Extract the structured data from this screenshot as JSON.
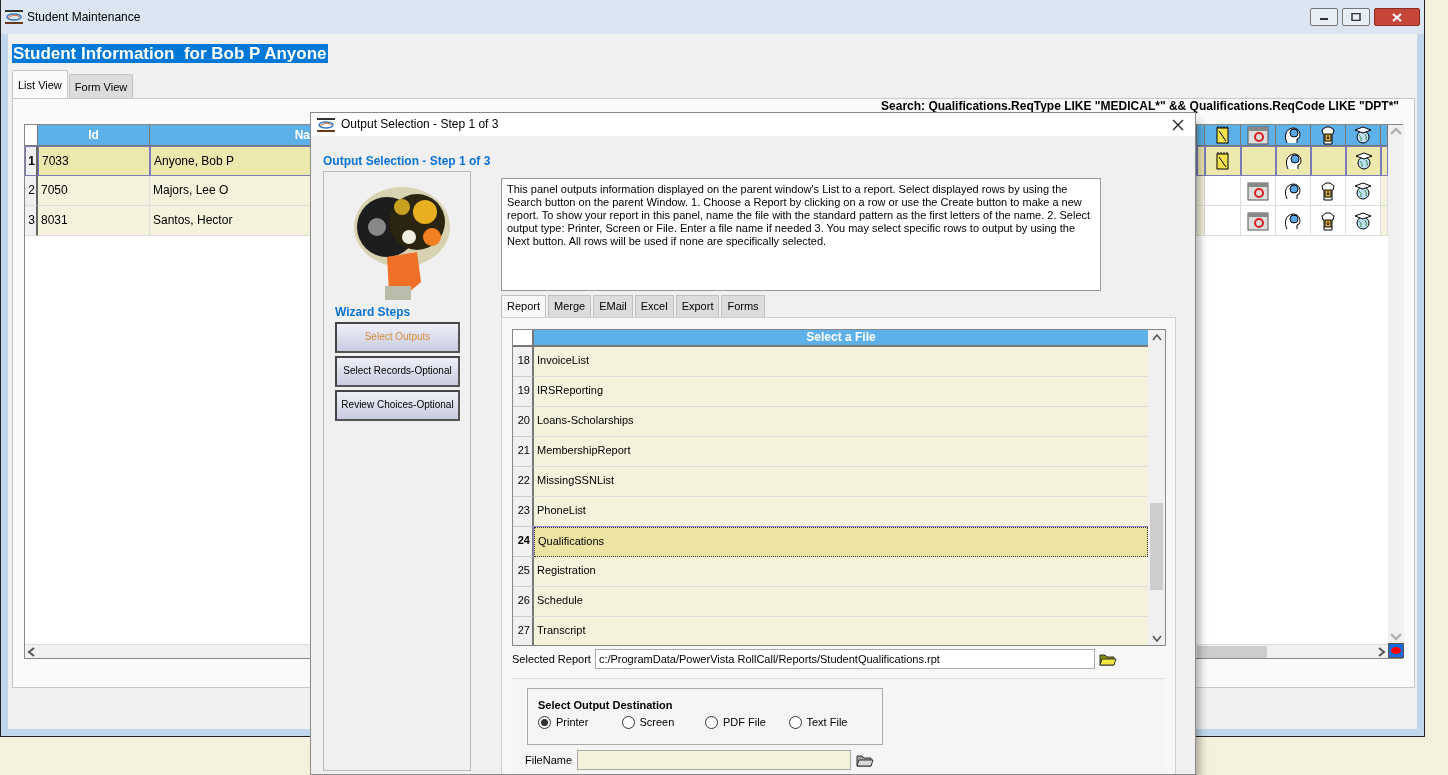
{
  "window": {
    "title": "Student Maintenance"
  },
  "heading": "Student Information  for Bob P Anyone",
  "tabs": [
    {
      "label": "List View",
      "selected": true
    },
    {
      "label": "Form View",
      "selected": false
    }
  ],
  "search_text": "Search: Qualifications.ReqType  LIKE \"MEDICAL*\" && Qualifications.ReqCode  LIKE \"DPT*\"",
  "table": {
    "columns": [
      "Id",
      "Na"
    ],
    "rows": [
      {
        "number": "1",
        "id": "7033",
        "name": "Anyone, Bob P",
        "selected": true,
        "icons_shown": [
          true,
          false,
          true,
          false,
          true
        ]
      },
      {
        "number": "2",
        "id": "7050",
        "name": "Majors, Lee O",
        "selected": false,
        "icons_shown": [
          false,
          true,
          true,
          true,
          true
        ]
      },
      {
        "number": "3",
        "id": "8031",
        "name": "Santos, Hector",
        "selected": false,
        "icons_shown": [
          false,
          true,
          true,
          true,
          true
        ]
      }
    ]
  },
  "dialog": {
    "title": "Output Selection - Step 1 of 3",
    "heading": "Output Selection - Step 1 of 3",
    "wizard_label": "Wizard Steps",
    "steps": [
      {
        "label": "Select Outputs",
        "selected": true
      },
      {
        "label": "Select Records-Optional",
        "selected": false
      },
      {
        "label": "Review Choices-Optional",
        "selected": false
      }
    ],
    "description": "This panel outputs information displayed on the parent window's List to a report. Select displayed rows by using the Search button on the parent Window. 1. Choose a Report by clicking on a row or use the Create button to make a new report. To show your report in this panel, name the file with the standard pattern as the first letters of the name. 2. Select output type: Printer, Screen or File. Enter a file name if needed 3. You may select specific rows to output by using the Next button. All rows will be used if none are specifically selected.",
    "tabs": [
      {
        "label": "Report",
        "selected": true
      },
      {
        "label": "Merge",
        "selected": false
      },
      {
        "label": "EMail",
        "selected": false
      },
      {
        "label": "Excel",
        "selected": false
      },
      {
        "label": "Export",
        "selected": false
      },
      {
        "label": "Forms",
        "selected": false
      }
    ],
    "file_list": {
      "column": "Select a File",
      "rows": [
        {
          "number": "18",
          "name": "InvoiceList",
          "selected": false
        },
        {
          "number": "19",
          "name": "IRSReporting",
          "selected": false
        },
        {
          "number": "20",
          "name": "Loans-Scholarships",
          "selected": false
        },
        {
          "number": "21",
          "name": "MembershipReport",
          "selected": false
        },
        {
          "number": "22",
          "name": "MissingSSNList",
          "selected": false
        },
        {
          "number": "23",
          "name": "PhoneList",
          "selected": false
        },
        {
          "number": "24",
          "name": "Qualifications",
          "selected": true
        },
        {
          "number": "25",
          "name": "Registration",
          "selected": false
        },
        {
          "number": "26",
          "name": "Schedule",
          "selected": false
        },
        {
          "number": "27",
          "name": "Transcript",
          "selected": false
        }
      ]
    },
    "selected_report": {
      "label": "Selected Report",
      "value": "c:/ProgramData/PowerVista RollCall/Reports/StudentQualifications.rpt"
    },
    "destination": {
      "title": "Select Output Destination",
      "options": [
        {
          "label": "Printer",
          "selected": true
        },
        {
          "label": "Screen",
          "selected": false
        },
        {
          "label": "PDF File",
          "selected": false
        },
        {
          "label": "Text File",
          "selected": false
        }
      ]
    },
    "file_name": {
      "label": "FileName"
    }
  }
}
